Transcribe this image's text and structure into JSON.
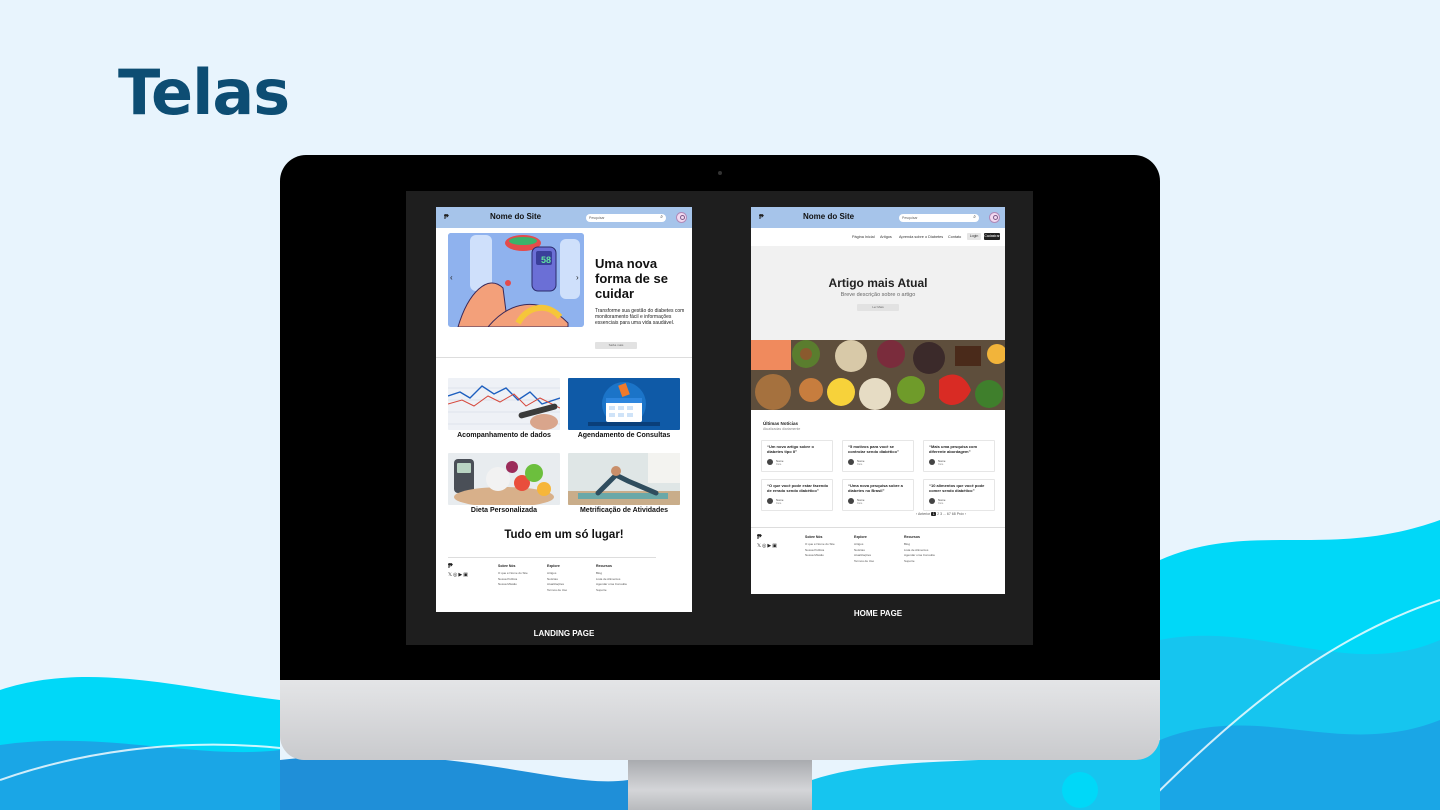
{
  "slide": {
    "title": "Telas"
  },
  "colors": {
    "background": "#e8f4fd",
    "title": "#0d4d73",
    "wave": "#00d8f8",
    "mock_header": "#a6c4ea"
  },
  "landing": {
    "caption": "LANDING PAGE",
    "header": {
      "logo_icon": "brand-logo-icon",
      "site_name": "Nome do Site",
      "search_placeholder": "Pesquisar",
      "search_icon": "search-icon",
      "avatar_icon": "user-avatar-icon"
    },
    "hero": {
      "headline": "Uma nova forma de se cuidar",
      "body": "Transforme sua gestão do diabetes com monitoramento fácil e informações essenciais para uma vida saudável.",
      "button": "Saiba mais",
      "glucometer_value": "58"
    },
    "features": [
      {
        "label": "Acompanhamento de dados"
      },
      {
        "label": "Agendamento de Consultas"
      },
      {
        "label": "Dieta Personalizada"
      },
      {
        "label": "Metrificação de Atividades"
      }
    ],
    "tagline": "Tudo em um só lugar!",
    "footer": {
      "columns": [
        {
          "heading": "Sobre Nós",
          "items": [
            "O que é Nome do Site",
            "Nossa Política",
            "Nossa Missão"
          ]
        },
        {
          "heading": "Explore",
          "items": [
            "Artigos",
            "Notícias",
            "Atualizações",
            "Termos de Uso"
          ]
        },
        {
          "heading": "Recursos",
          "items": [
            "Blog",
            "Lista de Alimentos",
            "Agendar uma Consulta",
            "Suporte"
          ]
        }
      ]
    }
  },
  "home": {
    "caption": "HOME PAGE",
    "header": {
      "site_name": "Nome do Site",
      "search_placeholder": "Pesquisar"
    },
    "nav": {
      "links": [
        "Página Inicial",
        "Artigos",
        "Aprenda sobre o Diabetes",
        "Contato"
      ],
      "login": "Login",
      "signup": "Cadastrar"
    },
    "featured": {
      "title": "Artigo mais Atual",
      "subtitle": "Breve descrição sobre o artigo",
      "button": "Ler Mais"
    },
    "latest": {
      "heading": "Últimas Notícias",
      "subheading": "Atualizadas diariamente",
      "cards": [
        {
          "title": "“Um novo artigo sobre o diabetes tipo II”",
          "author": "Nome",
          "date": "Data"
        },
        {
          "title": "“5 motivos para você se controlar sendo diabético”",
          "author": "Nome",
          "date": "Data"
        },
        {
          "title": "“Mais uma pesquisa com diferente abordagem”",
          "author": "Nome",
          "date": "Data"
        },
        {
          "title": "“O que você pode estar fazendo de errado sendo diabético”",
          "author": "Nome",
          "date": "Data"
        },
        {
          "title": "“Uma nova pesquisa sobre a diabetes no Brasil”",
          "author": "Nome",
          "date": "Data"
        },
        {
          "title": "“10 alimentos que você pode comer sendo diabético”",
          "author": "Nome",
          "date": "Data"
        }
      ]
    },
    "pagination": {
      "prev": "‹ Anterior",
      "pages": [
        "1",
        "2",
        "3",
        "...",
        "67",
        "68"
      ],
      "current": "1",
      "next": "Próx ›"
    },
    "footer": {
      "columns": [
        {
          "heading": "Sobre Nós",
          "items": [
            "O que é Nome do Site",
            "Nossa Política",
            "Nossa Missão"
          ]
        },
        {
          "heading": "Explore",
          "items": [
            "Artigos",
            "Notícias",
            "Atualizações",
            "Termos de Uso"
          ]
        },
        {
          "heading": "Recursos",
          "items": [
            "Blog",
            "Lista de Alimentos",
            "Agendar uma Consulta",
            "Suporte"
          ]
        }
      ]
    }
  }
}
